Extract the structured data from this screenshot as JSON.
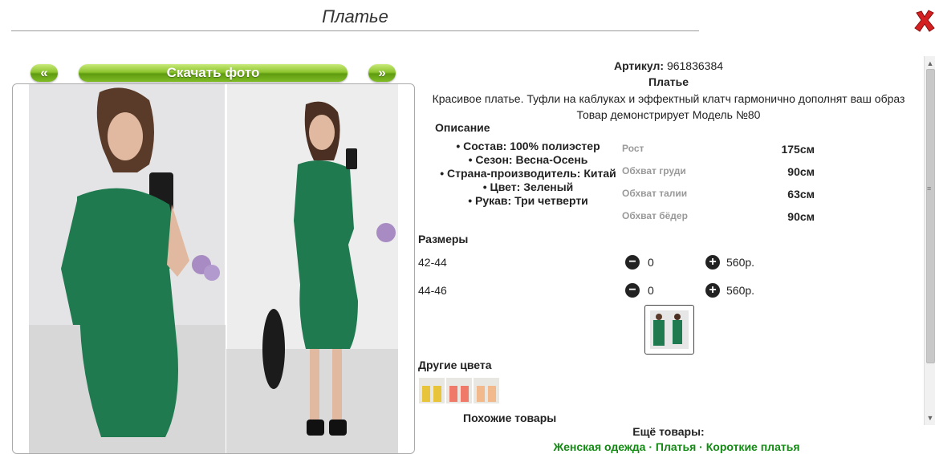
{
  "header": {
    "title": "Платье"
  },
  "gallery": {
    "prev_label": "«",
    "download_label": "Скачать фото",
    "next_label": "»"
  },
  "product": {
    "article_label": "Артикул:",
    "article_value": "961836384",
    "name": "Платье",
    "description": "Красивое платье. Туфли на каблуках и эффектный клатч гармонично дополнят ваш образ",
    "model_note": "Товар демонстрирует Модель №80"
  },
  "description_section": {
    "title": "Описание",
    "items": [
      "Состав: 100% полиэстер",
      "Сезон: Весна-Осень",
      "Страна-производитель: Китай",
      "Цвет: Зеленый",
      "Рукав: Три четверти"
    ]
  },
  "measurements": [
    {
      "label": "Рост",
      "value": "175см"
    },
    {
      "label": "Обхват груди",
      "value": "90см"
    },
    {
      "label": "Обхват талии",
      "value": "63см"
    },
    {
      "label": "Обхват бёдер",
      "value": "90см"
    }
  ],
  "sizes": {
    "title": "Размеры",
    "rows": [
      {
        "size": "42-44",
        "qty": "0",
        "price": "560р."
      },
      {
        "size": "44-46",
        "qty": "0",
        "price": "560р."
      }
    ]
  },
  "other_colors": {
    "title": "Другие цвета",
    "swatches": [
      "#e8c43a",
      "#ef7a6a",
      "#f2b98c"
    ]
  },
  "similar": {
    "title": "Похожие товары"
  },
  "more": {
    "title": "Ещё товары:",
    "links_text": "Женская одежда · Платья · Короткие платья"
  },
  "colors": {
    "accent_green": "#7fbc25",
    "dress_green": "#1f7a4f",
    "link_green": "#138a13",
    "close_red": "#d42020"
  }
}
